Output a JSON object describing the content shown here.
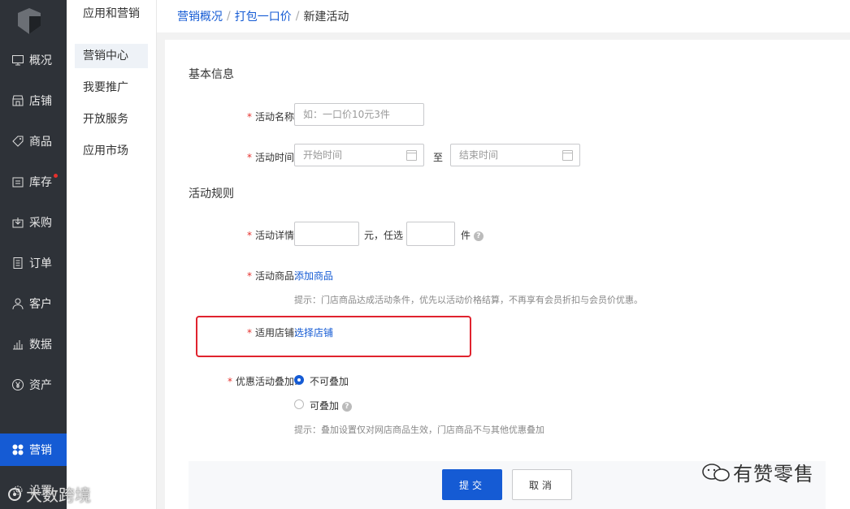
{
  "nav": {
    "items": [
      {
        "label": "概况",
        "icon": "monitor-icon"
      },
      {
        "label": "店铺",
        "icon": "store-icon"
      },
      {
        "label": "商品",
        "icon": "tag-icon"
      },
      {
        "label": "库存",
        "icon": "inventory-icon",
        "badge": true
      },
      {
        "label": "采购",
        "icon": "purchase-icon"
      },
      {
        "label": "订单",
        "icon": "order-icon"
      },
      {
        "label": "客户",
        "icon": "user-icon"
      },
      {
        "label": "数据",
        "icon": "bar-chart-icon"
      },
      {
        "label": "资产",
        "icon": "yen-icon"
      },
      {
        "label": "营销",
        "icon": "grid-icon",
        "active": true
      },
      {
        "label": "设置",
        "icon": "gear-icon"
      }
    ]
  },
  "subnav": {
    "title": "应用和营销",
    "items": [
      {
        "label": "营销中心",
        "active": true
      },
      {
        "label": "我要推广"
      },
      {
        "label": "开放服务"
      },
      {
        "label": "应用市场"
      }
    ]
  },
  "breadcrumb": {
    "items": [
      "营销概况",
      "打包一口价"
    ],
    "separator": "/",
    "current": "新建活动"
  },
  "form": {
    "basic_title": "基本信息",
    "name_label": "活动名称:",
    "name_placeholder": "如：一口价10元3件",
    "time_label": "活动时间:",
    "start_placeholder": "开始时间",
    "to_text": "至",
    "end_placeholder": "结束时间",
    "rules_title": "活动规则",
    "detail_label": "活动详情:",
    "yuan_text": "元，任选",
    "jian_text": "件",
    "goods_label": "活动商品:",
    "add_goods": "添加商品",
    "goods_hint": "提示：门店商品达成活动条件，优先以活动价格结算，不再享有会员折扣与会员价优惠。",
    "store_label": "适用店铺:",
    "select_store": "选择店铺",
    "stack_label": "优惠活动叠加:",
    "opt_no_stack": "不可叠加",
    "opt_stack": "可叠加",
    "stack_hint": "提示：叠加设置仅对网店商品生效，门店商品不与其他优惠叠加",
    "required_mark": "*",
    "help_mark": "?"
  },
  "actions": {
    "submit": "提交",
    "cancel": "取消"
  },
  "watermarks": {
    "right": "有赞零售",
    "left": "大数跨境"
  },
  "colors": {
    "accent": "#155bd4",
    "highlight": "#e0232e",
    "nav_bg": "#2e3238"
  }
}
